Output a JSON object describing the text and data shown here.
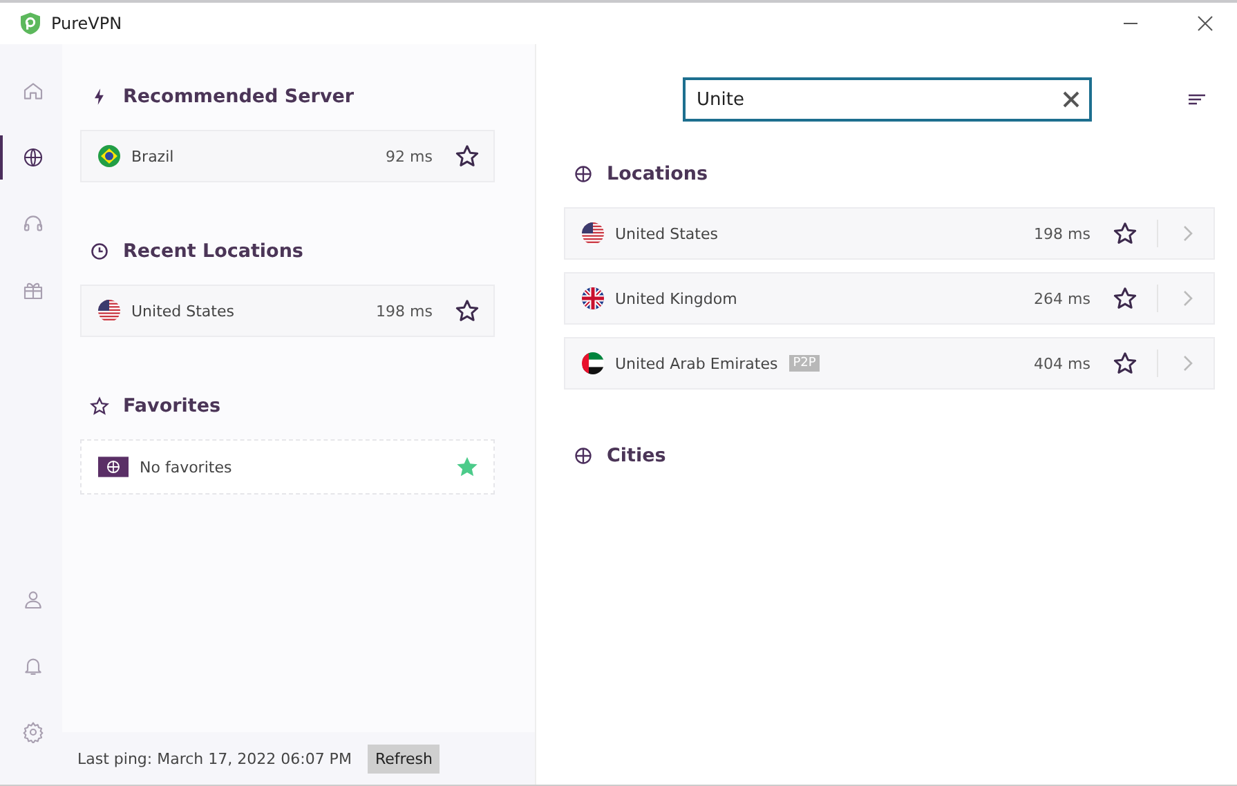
{
  "window": {
    "title": "PureVPN"
  },
  "nav": [
    {
      "selected": false
    },
    {
      "selected": true
    },
    {
      "selected": false
    },
    {
      "selected": false
    }
  ],
  "nav_bottom": [
    {
      "selected": false
    },
    {
      "selected": false
    },
    {
      "selected": false
    }
  ],
  "recommended": {
    "title": "Recommended Server",
    "items": [
      {
        "name": "Brazil",
        "ping": "92 ms",
        "favorite": false
      }
    ]
  },
  "recent": {
    "title": "Recent Locations",
    "items": [
      {
        "name": "United States",
        "ping": "198 ms",
        "favorite": false
      }
    ]
  },
  "favorites": {
    "title": "Favorites",
    "empty_text": "No favorites"
  },
  "footer": {
    "last_ping": "Last ping: March 17, 2022 06:07 PM",
    "refresh": "Refresh"
  },
  "search": {
    "value": "Unite"
  },
  "locations": {
    "title": "Locations",
    "items": [
      {
        "name": "United States",
        "ping": "198 ms",
        "favorite": false
      },
      {
        "name": "United Kingdom",
        "ping": "264 ms",
        "favorite": false
      },
      {
        "name": "United Arab Emirates",
        "tag": "P2P",
        "ping": "404 ms",
        "favorite": false
      }
    ]
  },
  "cities": {
    "title": "Cities"
  }
}
